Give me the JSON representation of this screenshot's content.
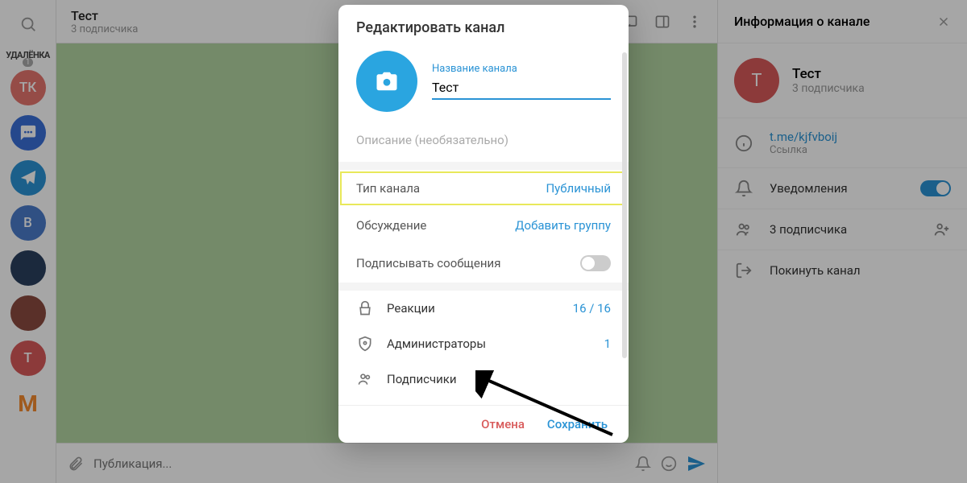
{
  "header": {
    "title": "Тест",
    "subtitle": "3 подписчика"
  },
  "rail": {
    "badge_text": "УДАЛЁНКА",
    "badge_count": "1",
    "tk": "ТК",
    "b": "В",
    "t": "T",
    "m": "M"
  },
  "composer": {
    "placeholder": "Публикация..."
  },
  "rightPanel": {
    "title": "Информация о канале",
    "name": "Тест",
    "sub": "3 подписчика",
    "link": "t.me/kjfvboij",
    "link_label": "Ссылка",
    "notifications": "Уведомления",
    "subscribers": "3 подписчика",
    "leave": "Покинуть канал"
  },
  "modal": {
    "title": "Редактировать канал",
    "name_label": "Название канала",
    "name_value": "Тест",
    "desc_placeholder": "Описание (необязательно)",
    "type_label": "Тип канала",
    "type_value": "Публичный",
    "discussion_label": "Обсуждение",
    "discussion_value": "Добавить группу",
    "sign_label": "Подписывать сообщения",
    "reactions_label": "Реакции",
    "reactions_value": "16 / 16",
    "admins_label": "Администраторы",
    "admins_value": "1",
    "subs_label": "Подписчики",
    "cancel": "Отмена",
    "save": "Сохранить"
  }
}
